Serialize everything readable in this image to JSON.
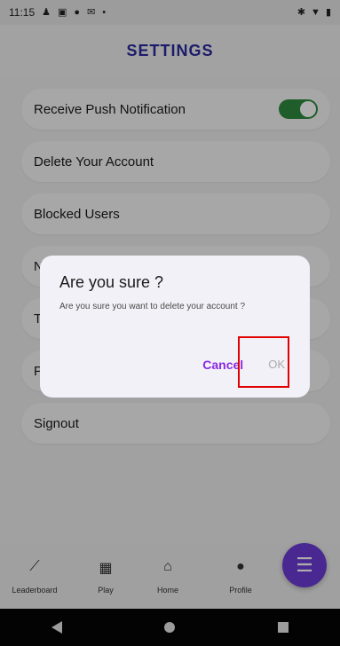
{
  "status_bar": {
    "time": "11:15",
    "left_icons": [
      "person-icon",
      "photo-icon",
      "apple-icon",
      "mail-icon",
      "dot-icon"
    ],
    "right_icons": [
      "bluetooth-icon",
      "wifi-icon",
      "battery-icon"
    ]
  },
  "header": {
    "title": "SETTINGS"
  },
  "settings": {
    "items": [
      {
        "label": "Receive Push Notification",
        "toggle_on": true
      },
      {
        "label": "Delete Your Account"
      },
      {
        "label": "Blocked Users"
      },
      {
        "label": "N"
      },
      {
        "label": "T"
      },
      {
        "label": "P"
      },
      {
        "label": "Signout"
      }
    ]
  },
  "dialog": {
    "title": "Are you sure ?",
    "message": "Are you sure you want to delete your account ?",
    "cancel_label": "Cancel",
    "ok_label": "OK"
  },
  "bottom_nav": {
    "tabs": [
      {
        "label": "Leaderboard",
        "icon": "chart-icon"
      },
      {
        "label": "Play",
        "icon": "grid-icon"
      },
      {
        "label": "Home",
        "icon": "home-icon"
      },
      {
        "label": "Profile",
        "icon": "person-icon"
      }
    ],
    "fab_icon": "menu-icon"
  },
  "colors": {
    "title": "#2a2a9e",
    "toggle_on": "#2e8b3e",
    "accent": "#8a2be2",
    "fab": "#6d3cd6",
    "highlight": "#e00000"
  }
}
